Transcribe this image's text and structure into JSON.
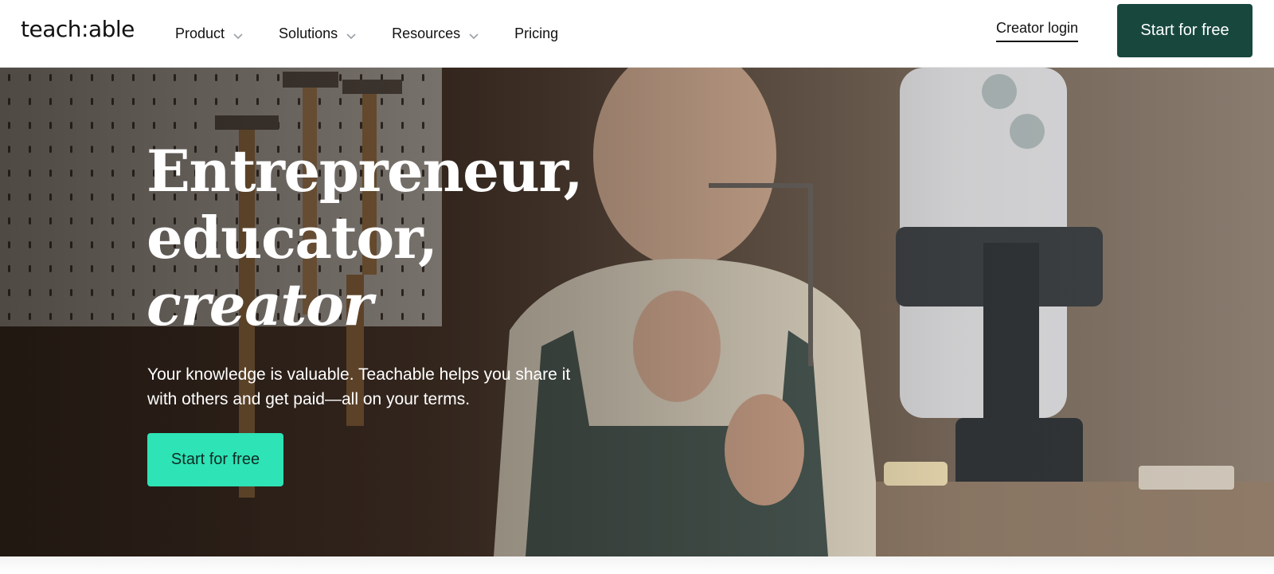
{
  "brand": {
    "logo_text": "teach:able"
  },
  "nav": {
    "items": [
      {
        "label": "Product",
        "has_dropdown": true
      },
      {
        "label": "Solutions",
        "has_dropdown": true
      },
      {
        "label": "Resources",
        "has_dropdown": true
      },
      {
        "label": "Pricing",
        "has_dropdown": false
      }
    ],
    "login_label": "Creator login",
    "cta_label": "Start for free"
  },
  "hero": {
    "headline_line1": "Entrepreneur,",
    "headline_line2": "educator,",
    "headline_line3": "creator",
    "subtext": "Your knowledge is valuable. Teachable helps you share it with others and get paid—all on your terms.",
    "cta_label": "Start for free"
  },
  "colors": {
    "nav_cta_bg": "#18473e",
    "hero_cta_bg": "#2ee3b5",
    "text_dark": "#111111"
  },
  "icons": [
    "chevron-down-icon"
  ]
}
